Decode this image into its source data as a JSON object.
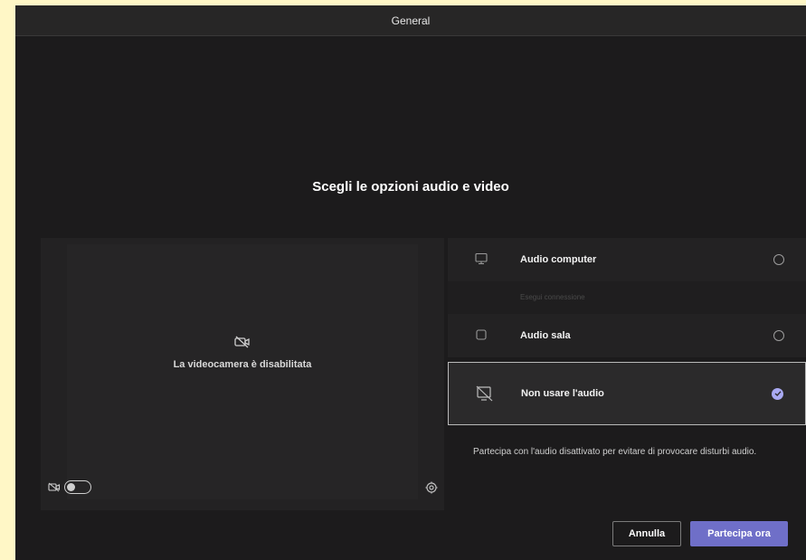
{
  "window": {
    "title": "General"
  },
  "heading": "Scegli le opzioni audio e video",
  "preview": {
    "camera_off_text": "La videocamera è disabilitata",
    "camera_toggle": "off"
  },
  "audio_options": [
    {
      "label": "Audio computer",
      "icon": "computer-audio-icon",
      "selected": false
    },
    {
      "label": "Audio sala",
      "icon": "room-audio-icon",
      "selected": false
    },
    {
      "label": "Non usare l'audio",
      "icon": "no-audio-icon",
      "selected": true
    }
  ],
  "faded_option_text": "Esegui connessione",
  "description": "Partecipa con l'audio disattivato per evitare di provocare disturbi audio.",
  "buttons": {
    "cancel": "Annulla",
    "join": "Partecipa ora"
  },
  "colors": {
    "background": "#1c1b1c",
    "accent": "#6f6fc8",
    "check": "#a9a9f2"
  }
}
